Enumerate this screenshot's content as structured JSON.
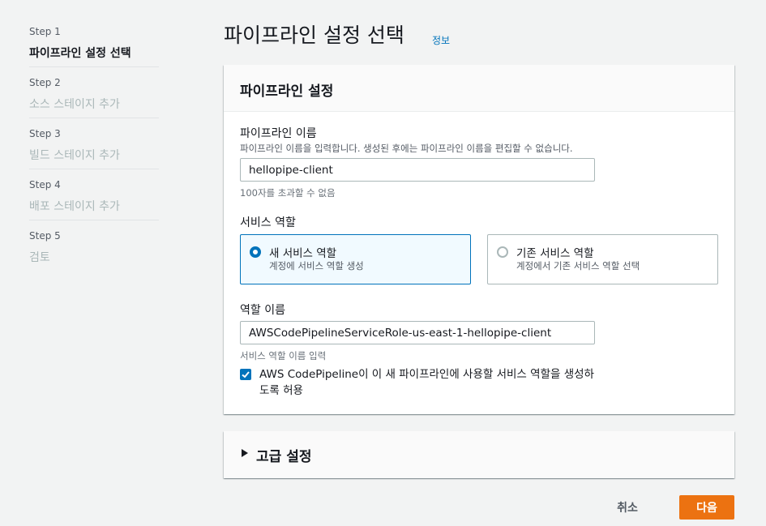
{
  "steps": [
    {
      "num": "Step 1",
      "label": "파이프라인 설정 선택"
    },
    {
      "num": "Step 2",
      "label": "소스 스테이지 추가"
    },
    {
      "num": "Step 3",
      "label": "빌드 스테이지 추가"
    },
    {
      "num": "Step 4",
      "label": "배포 스테이지 추가"
    },
    {
      "num": "Step 5",
      "label": "검토"
    }
  ],
  "page": {
    "title": "파이프라인 설정 선택",
    "info_link": "정보"
  },
  "settings": {
    "panel_title": "파이프라인 설정",
    "name_label": "파이프라인 이름",
    "name_desc": "파이프라인 이름을 입력합니다. 생성된 후에는 파이프라인 이름을 편집할 수 없습니다.",
    "name_value": "hellopipe-client",
    "name_constraint": "100자를 초과할 수 없음",
    "role_label": "서비스 역할",
    "role_options": [
      {
        "title": "새 서비스 역할",
        "desc": "계정에 서비스 역할 생성",
        "selected": true
      },
      {
        "title": "기존 서비스 역할",
        "desc": "계정에서 기존 서비스 역할 선택",
        "selected": false
      }
    ],
    "role_name_label": "역할 이름",
    "role_name_value": "AWSCodePipelineServiceRole-us-east-1-hellopipe-client",
    "role_name_constraint": "서비스 역할 이름 입력",
    "allow_checkbox_label": "AWS CodePipeline이 이 새 파이프라인에 사용할 서비스 역할을 생성하도록 허용",
    "allow_checked": true
  },
  "advanced": {
    "title": "고급 설정"
  },
  "actions": {
    "cancel": "취소",
    "next": "다음"
  },
  "colors": {
    "accent": "#0073bb",
    "primary_button": "#ec7211",
    "selected_tile_bg": "#f1faff"
  }
}
